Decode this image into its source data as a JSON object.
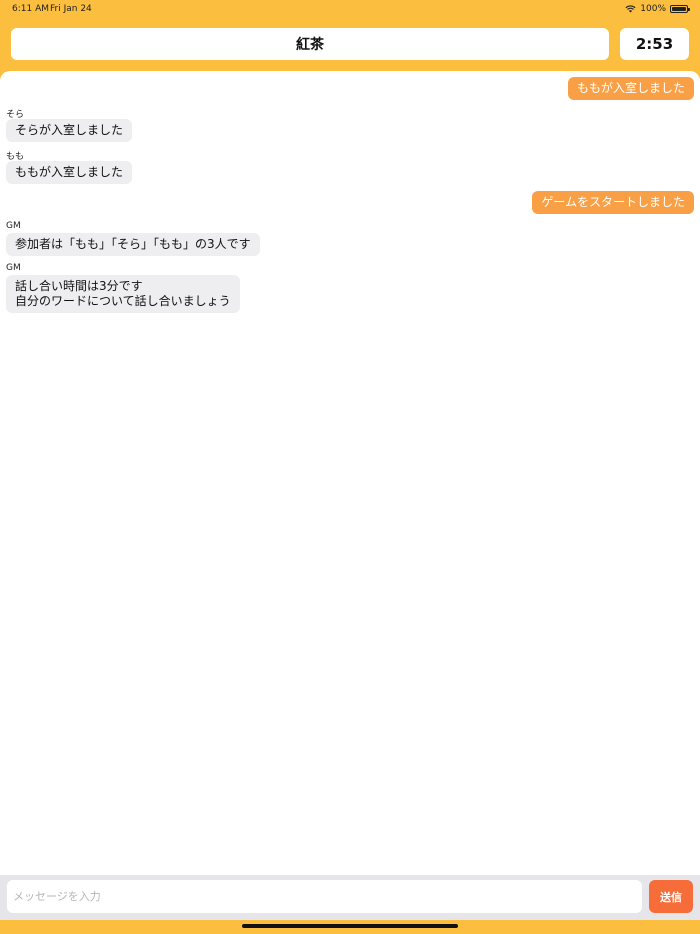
{
  "status_bar": {
    "time": "6:11 AM",
    "date": "Fri Jan 24",
    "battery": "100%",
    "wifi_icon": "wifi-icon",
    "battery_icon": "battery-icon"
  },
  "header": {
    "title": "紅茶",
    "timer": "2:53"
  },
  "messages": [
    {
      "sender": "",
      "text": "ももが入室しました",
      "mine": true
    },
    {
      "sender": "そら",
      "text": "そらが入室しました",
      "mine": false
    },
    {
      "sender": "もも",
      "text": "ももが入室しました",
      "mine": false
    },
    {
      "sender": "",
      "text": "ゲームをスタートしました",
      "mine": true
    },
    {
      "sender": "GM",
      "text": "参加者は「もも」「そら」「もも」の3人です",
      "mine": false
    },
    {
      "sender": "GM",
      "text_lines": [
        "話し合い時間は3分です",
        "自分のワードについて話し合いましょう"
      ],
      "mine": false
    }
  ],
  "input": {
    "placeholder": "メッセージを入力",
    "value": "",
    "send_label": "送信"
  },
  "colors": {
    "background": "#FBBE3F",
    "my_bubble": "#F9A046",
    "other_bubble": "#EEEEF1",
    "send_button": "#F76D3A"
  }
}
